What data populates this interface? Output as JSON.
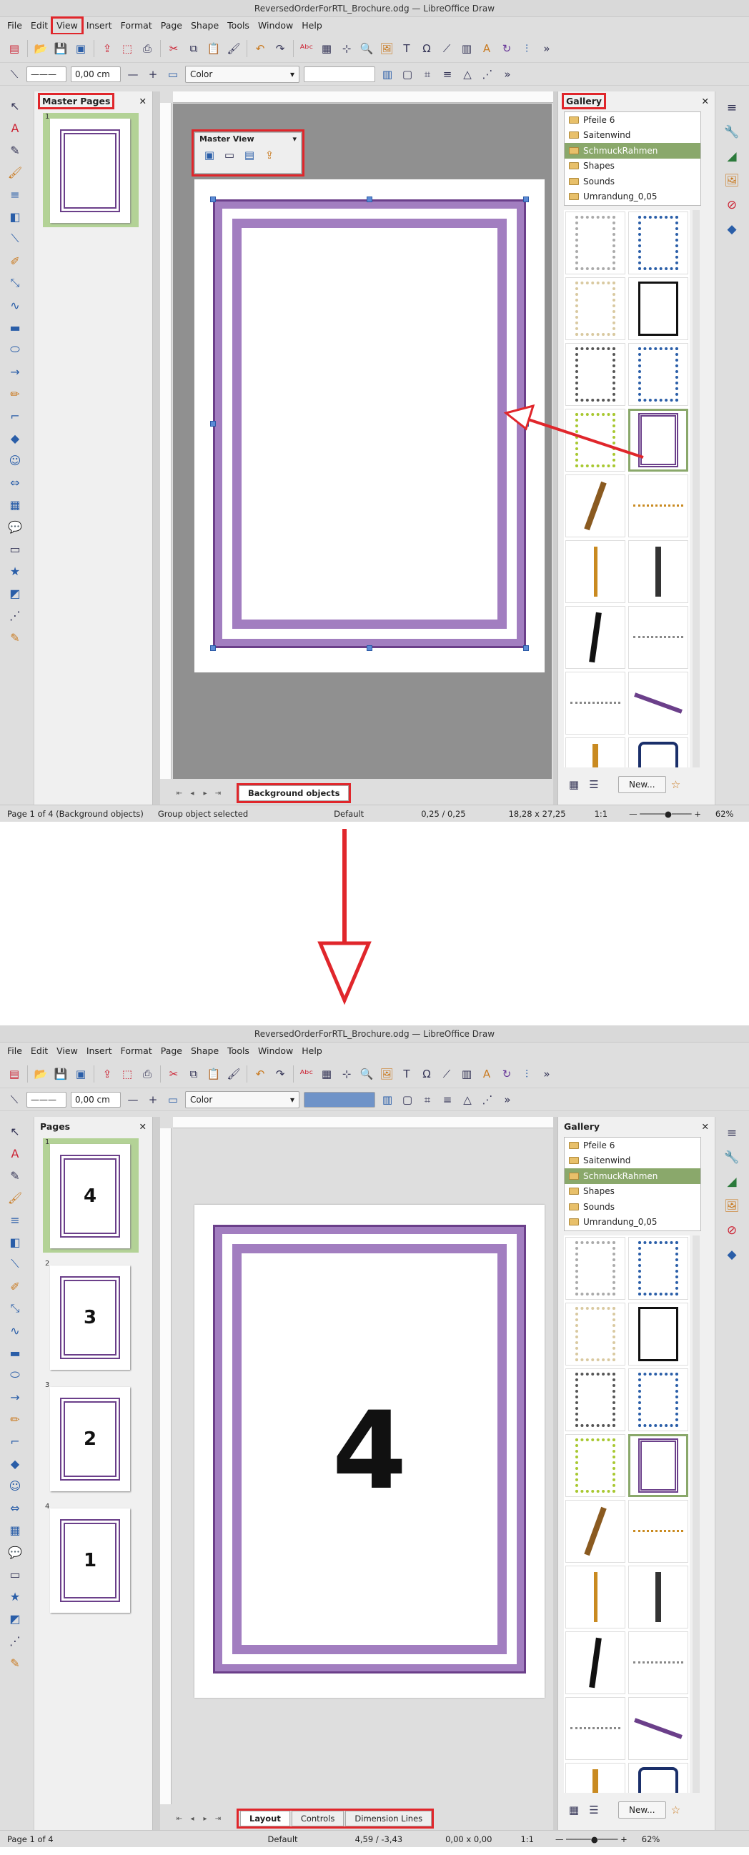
{
  "screenshot1": {
    "title": "ReversedOrderForRTL_Brochure.odg — LibreOffice Draw",
    "menu": [
      "File",
      "Edit",
      "View",
      "Insert",
      "Format",
      "Page",
      "Shape",
      "Tools",
      "Window",
      "Help"
    ],
    "line_width": "0,00 cm",
    "area_style": "Color",
    "panel_title": "Master Pages",
    "thumb_number": "1",
    "master_view_title": "Master View",
    "tabs": [
      "Background objects"
    ],
    "gallery_title": "Gallery",
    "themes": [
      "Pfeile 6",
      "Saitenwind",
      "SchmuckRahmen",
      "Shapes",
      "Sounds",
      "Umrandung_0,05"
    ],
    "new_button": "New...",
    "status": {
      "page": "Page 1 of 4 (Background objects)",
      "selection": "Group object selected",
      "style": "Default",
      "position": "0,25 / 0,25",
      "size": "18,28 x 27,25",
      "scale": "1:1",
      "zoom": "62%"
    }
  },
  "screenshot2": {
    "title": "ReversedOrderForRTL_Brochure.odg — LibreOffice Draw",
    "menu": [
      "File",
      "Edit",
      "View",
      "Insert",
      "Format",
      "Page",
      "Shape",
      "Tools",
      "Window",
      "Help"
    ],
    "line_width": "0,00 cm",
    "area_style": "Color",
    "panel_title": "Pages",
    "pages": [
      {
        "num": "1",
        "label": "4"
      },
      {
        "num": "2",
        "label": "3"
      },
      {
        "num": "3",
        "label": "2"
      },
      {
        "num": "4",
        "label": "1"
      }
    ],
    "big_label": "4",
    "tabs": [
      "Layout",
      "Controls",
      "Dimension Lines"
    ],
    "gallery_title": "Gallery",
    "themes": [
      "Pfeile 6",
      "Saitenwind",
      "SchmuckRahmen",
      "Shapes",
      "Sounds",
      "Umrandung_0,05"
    ],
    "new_button": "New...",
    "status": {
      "page": "Page 1 of 4",
      "style": "Default",
      "position": "4,59 / -3,43",
      "size": "0,00 x 0,00",
      "scale": "1:1",
      "zoom": "62%"
    }
  },
  "colors": {
    "highlight": "#e0262b",
    "selection_green": "#8aa86b",
    "frame_purple": "#a27ec0"
  }
}
